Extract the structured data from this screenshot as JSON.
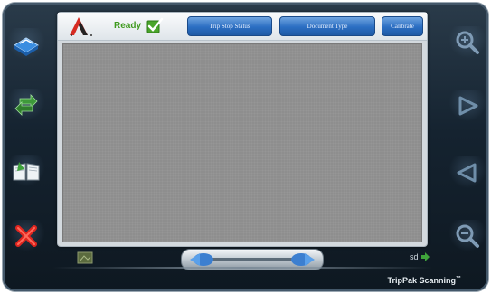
{
  "header": {
    "status_label": "Ready",
    "buttons": [
      {
        "label": "Trip Stop Status"
      },
      {
        "label": "Document Type"
      },
      {
        "label": "Calibrate"
      }
    ]
  },
  "footer": {
    "page_label": "sd",
    "brand": "TripPak Scanning",
    "trademark": "™"
  },
  "colors": {
    "ready_green": "#3f9a1e",
    "button_blue": "#2b6ec2",
    "preview_gray": "#8e8e8e",
    "bezel": "#152330"
  },
  "icons": {
    "left": [
      "scanner-icon",
      "refresh-icon",
      "open-book-icon",
      "delete-icon"
    ],
    "right": [
      "zoom-in-icon",
      "next-page-icon",
      "previous-page-icon",
      "zoom-out-icon"
    ]
  }
}
